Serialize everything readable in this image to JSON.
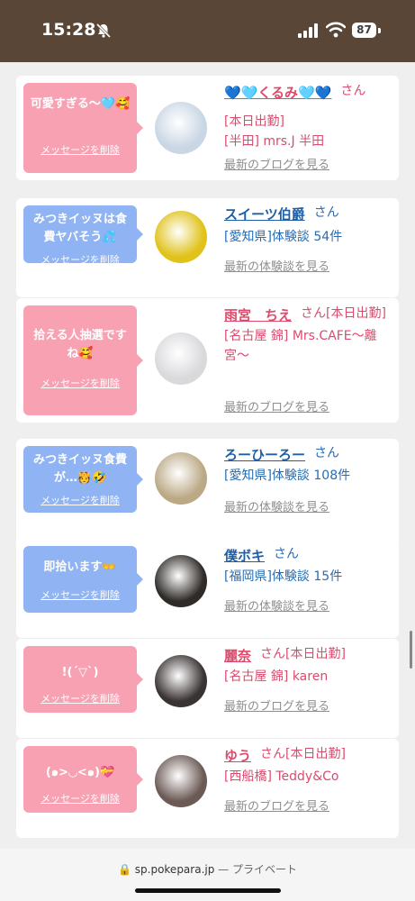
{
  "status": {
    "time": "15:28",
    "battery": "87"
  },
  "cards": [
    {
      "bubble_color": "pink",
      "message": "可愛すぎる〜🩵🥰",
      "delete_label": "メッセージを削除",
      "name": "💙🩵くるみ🩵💙",
      "san": "さん",
      "line1": "[本日出勤]",
      "line2": "[半田] mrs.J 半田",
      "link": "最新のブログを見る",
      "avatar_color": "#c9d6e4"
    },
    {
      "bubble_color": "blue",
      "message": "みつきイッヌは食費ヤバそう💦",
      "delete_label": "メッセージを削除",
      "name": "スイーツ伯爵",
      "san": "さん",
      "line1": "[愛知県]体験談 54件",
      "line2": "",
      "link": "最新の体験談を見る",
      "avatar_color": "#e0c21a"
    },
    {
      "bubble_color": "pink",
      "message": "拾える人抽選ですね🥰",
      "delete_label": "メッセージを削除",
      "name": "雨宮　ちえ",
      "san": "さん[本日出勤]",
      "line1": "[名古屋 錦] Mrs.CAFE〜離宮〜",
      "line2": "",
      "link": "最新のブログを見る",
      "avatar_color": "#d9d9dc"
    },
    {
      "bubble_color": "blue",
      "message": "みつきイッヌ食費が…🫅🤣",
      "delete_label": "メッセージを削除",
      "name": "ろーひーろー",
      "san": "さん",
      "line1": "[愛知県]体験談 108件",
      "line2": "",
      "link": "最新の体験談を見る",
      "avatar_color": "#bba985"
    },
    {
      "bubble_color": "blue",
      "message": "即拾います👐",
      "delete_label": "メッセージを削除",
      "name": "僕ボキ",
      "san": "さん",
      "line1": "[福岡県]体験談 15件",
      "line2": "",
      "link": "最新の体験談を見る",
      "avatar_color": "#2f2b28"
    },
    {
      "bubble_color": "pink",
      "message": "!(´▽`)",
      "delete_label": "メッセージを削除",
      "name": "麗奈",
      "san": "さん[本日出勤]",
      "line1": "[名古屋 錦] karen",
      "line2": "",
      "link": "最新のブログを見る",
      "avatar_color": "#3a3333"
    },
    {
      "bubble_color": "pink",
      "message": "(๑>◡<๑)💝",
      "delete_label": "メッセージを削除",
      "name": "ゆう",
      "san": "さん[本日出勤]",
      "line1": "[西船橋] Teddy&Co",
      "line2": "",
      "link": "最新のブログを見る",
      "avatar_color": "#6b5a55"
    }
  ],
  "browser": {
    "url": "sp.pokepara.jp",
    "privacy": "— プライベート"
  }
}
